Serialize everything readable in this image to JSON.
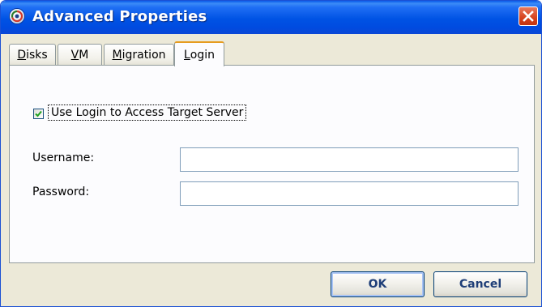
{
  "window": {
    "title": "Advanced Properties",
    "app_icon": "app-logo-icon",
    "close_icon": "close-icon"
  },
  "tabs": [
    {
      "label_ul": "D",
      "label_rest": "isks",
      "active": false
    },
    {
      "label_ul": "V",
      "label_rest": "M",
      "active": false
    },
    {
      "label_ul": "M",
      "label_rest": "igration",
      "active": false
    },
    {
      "label_ul": "L",
      "label_rest": "ogin",
      "active": true
    }
  ],
  "login": {
    "use_login_label": "Use Login to Access Target Server",
    "use_login_checked": true,
    "username_label": "Username:",
    "username_value": "",
    "password_label": "Password:",
    "password_value": ""
  },
  "buttons": {
    "ok_label": "OK",
    "cancel_label": "Cancel"
  },
  "colors": {
    "titlebar": "#0053e4",
    "close_button": "#d6421d",
    "active_tab_accent": "#e69c1f",
    "dialog_background": "#ece9d8",
    "button_text": "#1e3e78"
  }
}
